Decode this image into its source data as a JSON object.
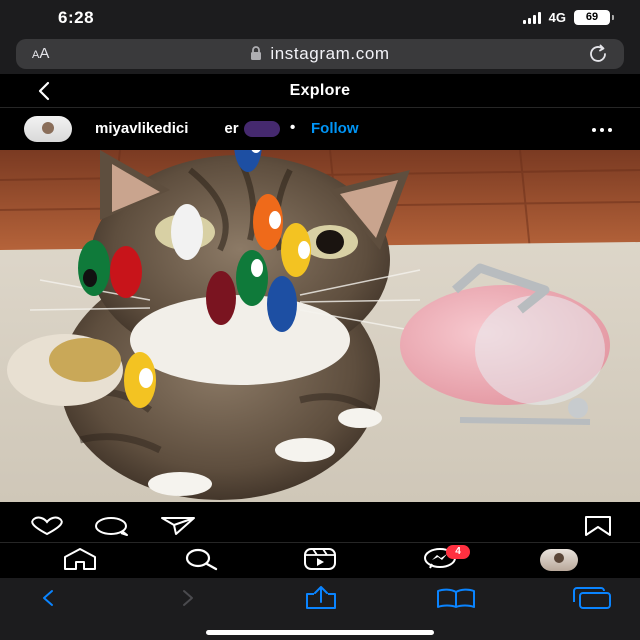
{
  "status_bar": {
    "time": "6:28",
    "network": "4G",
    "battery": "69"
  },
  "browser": {
    "text_size_label_small": "A",
    "text_size_label_large": "A",
    "url": "instagram.com"
  },
  "header": {
    "title": "Explore"
  },
  "post": {
    "username": "miyavlikedici",
    "username_tail": "er",
    "separator": "•",
    "follow_label": "Follow"
  },
  "nav": {
    "messages_badge": "4"
  },
  "icons": [
    "back-icon",
    "lock-icon",
    "reload-icon",
    "more-icon",
    "heart-icon",
    "comment-icon",
    "share-icon",
    "bookmark-icon",
    "home-icon",
    "search-icon",
    "reels-icon",
    "messenger-icon",
    "profile-avatar",
    "safari-back-icon",
    "safari-forward-icon",
    "safari-share-icon",
    "safari-bookmarks-icon",
    "safari-tabs-icon"
  ],
  "colors": {
    "follow_blue": "#0095f6",
    "badge_red": "#ff3040",
    "safari_blue": "#0a84ff"
  }
}
